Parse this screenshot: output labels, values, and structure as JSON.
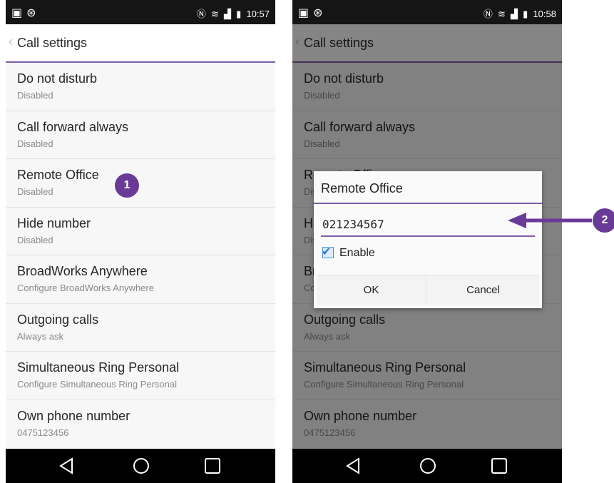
{
  "status_bar_left": {
    "time": "10:57"
  },
  "status_bar_right": {
    "time": "10:58"
  },
  "header": {
    "back_glyph": "‹",
    "title": "Call settings"
  },
  "items": [
    {
      "label": "Do not disturb",
      "sub": "Disabled"
    },
    {
      "label": "Call forward always",
      "sub": "Disabled"
    },
    {
      "label": "Remote Office",
      "sub": "Disabled"
    },
    {
      "label": "Hide number",
      "sub": "Disabled"
    },
    {
      "label": "BroadWorks Anywhere",
      "sub": "Configure BroadWorks Anywhere"
    },
    {
      "label": "Outgoing calls",
      "sub": "Always ask"
    },
    {
      "label": "Simultaneous Ring Personal",
      "sub": "Configure Simultaneous Ring Personal"
    },
    {
      "label": "Own phone number",
      "sub": "0475123456"
    }
  ],
  "dialog": {
    "title": "Remote Office",
    "input_value": "021234567",
    "checkbox_label": "Enable",
    "checkbox_checked": true,
    "ok_label": "OK",
    "cancel_label": "Cancel"
  },
  "markers": {
    "one": "1",
    "two": "2"
  },
  "colors": {
    "accent": "#7d5ba6",
    "marker": "#6a3a97",
    "statusbar": "#151515"
  },
  "icons": [
    "notification-icon",
    "nfc-icon",
    "wifi-icon",
    "signal-icon",
    "battery-icon",
    "back-nav-icon",
    "home-nav-icon",
    "recents-nav-icon",
    "back-chevron-icon",
    "checkmark-icon",
    "arrow-icon"
  ]
}
